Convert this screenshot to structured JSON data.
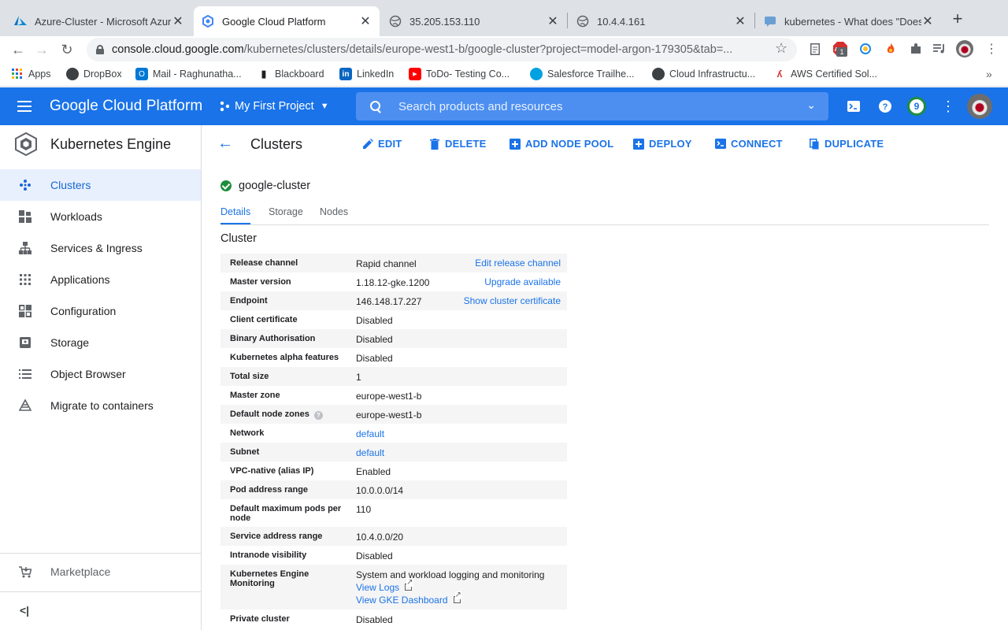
{
  "browser": {
    "tabs": [
      {
        "title": "Azure-Cluster - Microsoft Azur",
        "icon": "azure-icon"
      },
      {
        "title": "Google Cloud Platform",
        "icon": "gcp-icon"
      },
      {
        "title": "35.205.153.110",
        "icon": "globe-icon"
      },
      {
        "title": "10.4.4.161",
        "icon": "globe-icon"
      },
      {
        "title": "kubernetes - What does \"Does",
        "icon": "stackexchange-icon"
      }
    ],
    "url_host": "console.cloud.google.com",
    "url_path": "/kubernetes/clusters/details/europe-west1-b/google-cluster?project=model-argon-179305&tab=...",
    "bookmarks": [
      "Apps",
      "DropBox",
      "Mail - Raghunatha...",
      "Blackboard",
      "LinkedIn",
      "ToDo- Testing Co...",
      "Salesforce Trailhe...",
      "Cloud Infrastructu...",
      "AWS Certified Sol..."
    ],
    "abp_count": "1"
  },
  "header": {
    "brand": "Google Cloud Platform",
    "project": "My First Project",
    "search_placeholder": "Search products and resources",
    "notification_count": "9",
    "accent": "#1a73e8"
  },
  "sidebar": {
    "title": "Kubernetes Engine",
    "items": [
      {
        "label": "Clusters",
        "icon": "clusters-icon"
      },
      {
        "label": "Workloads",
        "icon": "workloads-icon"
      },
      {
        "label": "Services & Ingress",
        "icon": "services-icon"
      },
      {
        "label": "Applications",
        "icon": "applications-icon"
      },
      {
        "label": "Configuration",
        "icon": "configuration-icon"
      },
      {
        "label": "Storage",
        "icon": "storage-icon"
      },
      {
        "label": "Object Browser",
        "icon": "object-browser-icon"
      },
      {
        "label": "Migrate to containers",
        "icon": "migrate-icon"
      }
    ],
    "marketplace": "Marketplace",
    "collapse": "<|"
  },
  "main": {
    "title": "Clusters",
    "actions": [
      "EDIT",
      "DELETE",
      "ADD NODE POOL",
      "DEPLOY",
      "CONNECT",
      "DUPLICATE"
    ],
    "cluster_name": "google-cluster",
    "tabs": [
      "Details",
      "Storage",
      "Nodes"
    ],
    "section": "Cluster",
    "rows": [
      {
        "key": "Release channel",
        "value": "Rapid channel",
        "action": "Edit release channel"
      },
      {
        "key": "Master version",
        "value": "1.18.12-gke.1200",
        "action": "Upgrade available"
      },
      {
        "key": "Endpoint",
        "value": "146.148.17.227",
        "action": "Show cluster certificate"
      },
      {
        "key": "Client certificate",
        "value": "Disabled"
      },
      {
        "key": "Binary Authorisation",
        "value": "Disabled"
      },
      {
        "key": "Kubernetes alpha features",
        "value": "Disabled"
      },
      {
        "key": "Total size",
        "value": "1"
      },
      {
        "key": "Master zone",
        "value": "europe-west1-b"
      },
      {
        "key": "Default node zones",
        "value": "europe-west1-b"
      },
      {
        "key": "Network",
        "value": "default"
      },
      {
        "key": "Subnet",
        "value": "default"
      },
      {
        "key": "VPC-native (alias IP)",
        "value": "Enabled"
      },
      {
        "key": "Pod address range",
        "value": "10.0.0.0/14"
      },
      {
        "key": "Default maximum pods per node",
        "value": "110"
      },
      {
        "key": "Service address range",
        "value": "10.4.0.0/20"
      },
      {
        "key": "Intranode visibility",
        "value": "Disabled"
      },
      {
        "key": "Kubernetes Engine Monitoring",
        "value": "System and workload logging and monitoring",
        "links": [
          "View Logs",
          "View GKE Dashboard"
        ]
      },
      {
        "key": "Private cluster",
        "value": "Disabled"
      }
    ]
  }
}
